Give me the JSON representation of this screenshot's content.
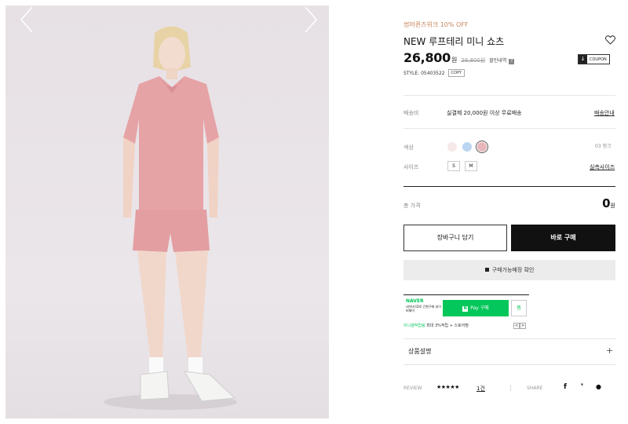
{
  "product": {
    "promo": "썸머퀸즈위크 10% OFF",
    "title": "NEW 루프테리 미니 쇼츠",
    "price": "26,800",
    "price_unit": "원",
    "original_price": "29,800원",
    "benefit_label": "할인내역",
    "benefit_q": "?",
    "coupon_label": "COUPON",
    "coupon_icon": "download-icon",
    "style_label": "STYLE. 05403522",
    "copy_label": "COPY"
  },
  "shipping": {
    "label": "배송비",
    "value": "실결제 20,000원 이상 무료배송",
    "link": "배송안내"
  },
  "options": {
    "color_label": "색상",
    "colors": [
      "#f6e9ea",
      "#bcd6f1",
      "#e7b6bb"
    ],
    "selected_color": "03 핑크",
    "size_label": "사이즈",
    "sizes": [
      "S",
      "M"
    ],
    "size_link": "실측사이즈"
  },
  "total": {
    "label": "총 가격",
    "value": "0",
    "unit": "원"
  },
  "buttons": {
    "cart": "장바구니 담기",
    "buy": "바로 구매",
    "store": "구매가능매장 확인"
  },
  "npay": {
    "logo": "NAVER",
    "sub": "네이버 ID로 간편구매 네이버페이",
    "pay_n": "N",
    "pay_label": "Pay 구매",
    "zzim": "찜",
    "event_green": "이니셜적립링",
    "event_rest": "최대 3%적립 + 스토어찜",
    "prev": "<",
    "next": ">"
  },
  "description": {
    "label": "상품설명",
    "plus": "+"
  },
  "review": {
    "label": "REVIEW",
    "stars": "★★★★★",
    "count": "1건",
    "share_label": "SHARE",
    "icons": [
      "f",
      "❜",
      "●"
    ]
  },
  "colors": {
    "promo": "#c8875d",
    "naver_green": "#03c75a",
    "buy_button": "#111111"
  }
}
